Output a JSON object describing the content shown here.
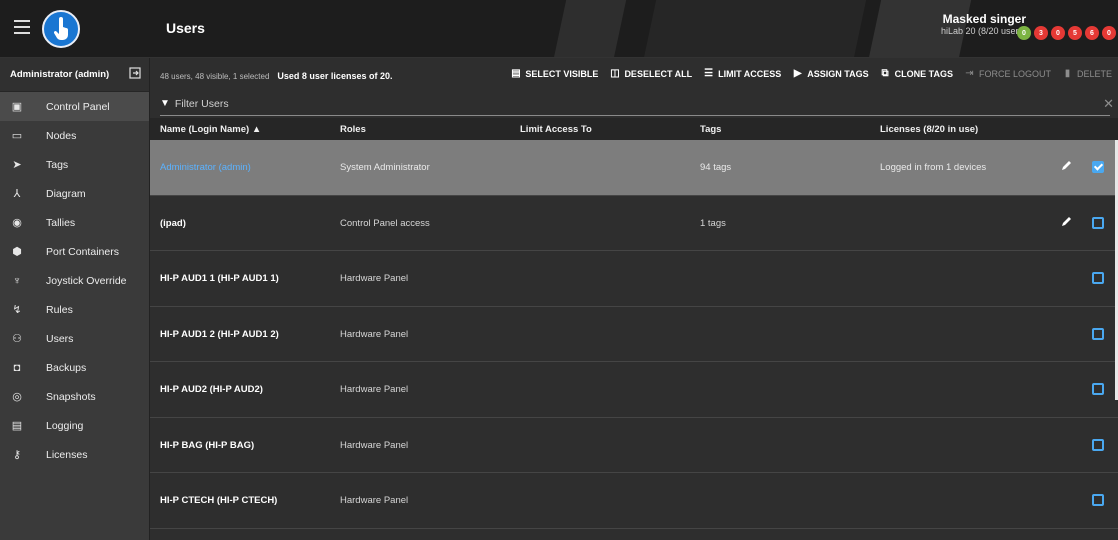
{
  "header": {
    "title": "Users",
    "user_name": "Masked singer",
    "user_sub": "hiLab 20 (8/20 users)",
    "status": [
      {
        "label": "0",
        "color": "#7cb342",
        "icon": "check-circle-icon"
      },
      {
        "label": "3",
        "color": "#e53935",
        "icon": "error-icon"
      },
      {
        "label": "0",
        "color": "#e53935",
        "icon": "error-icon"
      },
      {
        "label": "5",
        "color": "#e53935",
        "icon": "error-icon"
      },
      {
        "label": "6",
        "color": "#e53935",
        "icon": "error-icon"
      },
      {
        "label": "0",
        "color": "#e53935",
        "icon": "error-icon"
      }
    ]
  },
  "sidebar": {
    "header": "Administrator (admin)",
    "items": [
      {
        "label": "Control Panel",
        "icon": "control-panel-icon"
      },
      {
        "label": "Nodes",
        "icon": "nodes-icon"
      },
      {
        "label": "Tags",
        "icon": "tag-icon"
      },
      {
        "label": "Diagram",
        "icon": "diagram-icon"
      },
      {
        "label": "Tallies",
        "icon": "tally-icon"
      },
      {
        "label": "Port Containers",
        "icon": "port-container-icon"
      },
      {
        "label": "Joystick Override",
        "icon": "joystick-icon"
      },
      {
        "label": "Rules",
        "icon": "rules-icon"
      },
      {
        "label": "Users",
        "icon": "users-icon"
      },
      {
        "label": "Backups",
        "icon": "backup-icon"
      },
      {
        "label": "Snapshots",
        "icon": "snapshot-icon"
      },
      {
        "label": "Logging",
        "icon": "logging-icon"
      },
      {
        "label": "Licenses",
        "icon": "key-icon"
      }
    ]
  },
  "info": {
    "counts": "48 users, 48 visible, 1 selected",
    "licenses": "Used 8 user licenses of 20."
  },
  "toolbar": {
    "select_visible": "SELECT VISIBLE",
    "deselect_all": "DESELECT ALL",
    "limit_access": "LIMIT ACCESS",
    "assign_tags": "ASSIGN TAGS",
    "clone_tags": "CLONE TAGS",
    "force_logout": "FORCE LOGOUT",
    "delete": "DELETE"
  },
  "filter": {
    "placeholder": "Filter Users"
  },
  "table": {
    "columns": [
      "Name (Login Name) ▲",
      "Roles",
      "Limit Access To",
      "Tags",
      "Licenses (8/20 in use)"
    ],
    "rows": [
      {
        "name": "Administrator (admin)",
        "role": "System Administrator",
        "limit": "",
        "tags": "94 tags",
        "license": "Logged in from 1 devices",
        "editable": true,
        "selected": true
      },
      {
        "name": "(ipad)",
        "role": "Control Panel access",
        "limit": "",
        "tags": "1 tags",
        "license": "",
        "editable": true,
        "selected": false
      },
      {
        "name": "HI-P AUD1 1 (HI-P AUD1 1)",
        "role": "Hardware Panel",
        "limit": "",
        "tags": "",
        "license": "",
        "editable": false,
        "selected": false
      },
      {
        "name": "HI-P AUD1 2 (HI-P AUD1 2)",
        "role": "Hardware Panel",
        "limit": "",
        "tags": "",
        "license": "",
        "editable": false,
        "selected": false
      },
      {
        "name": "HI-P AUD2 (HI-P AUD2)",
        "role": "Hardware Panel",
        "limit": "",
        "tags": "",
        "license": "",
        "editable": false,
        "selected": false
      },
      {
        "name": "HI-P BAG (HI-P BAG)",
        "role": "Hardware Panel",
        "limit": "",
        "tags": "",
        "license": "",
        "editable": false,
        "selected": false
      },
      {
        "name": "HI-P CTECH (HI-P CTECH)",
        "role": "Hardware Panel",
        "limit": "",
        "tags": "",
        "license": "",
        "editable": false,
        "selected": false
      }
    ]
  },
  "colors": {
    "accent": "#4aa8f0",
    "link": "#5bb2ff",
    "selected_row": "#7d7d7d"
  }
}
